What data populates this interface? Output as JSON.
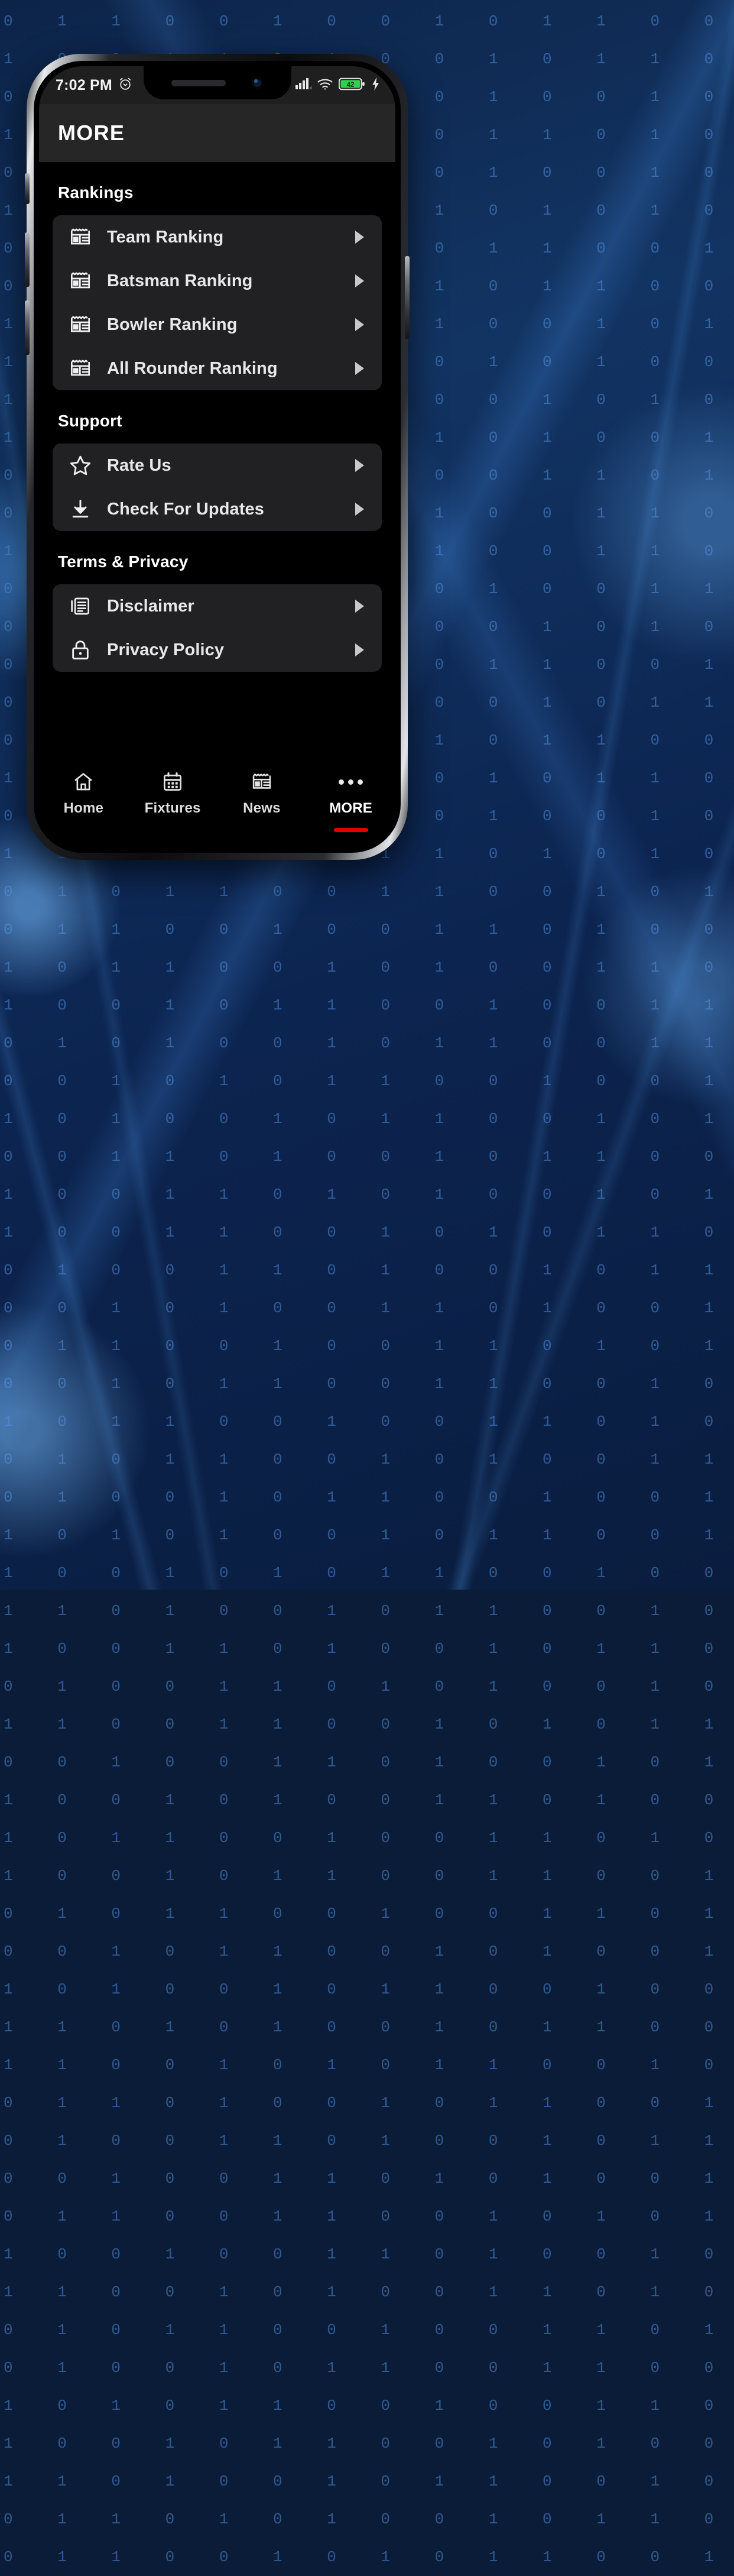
{
  "wallpaper": {
    "binary_pattern": "0 1 1 0 0 1 0 0 1 0 1 1 0 0 1 0 0 1 1 0 1 0 0 1 0 1 1 0 0 1 0 1 0 0 1 1 0 1 0 0 1 0 1 0 0 1 1 0 0 1 0 1 1 0 1 0 0 1 0 0 1 1 0 1 0 1 0 0 1 0 1 1 0 0 1 0 0 1 1 0 1 0 1 0 0 1 1 0 0 1 0 1 0 1 1 0 0 1 0 0 1 1 0 1 0 0 1 0 1 1 0 0 1 0 1 0 0 1 1 0 1 0 0 1 0 1 1 0 0 1 0 0 1 1 0 1 0 1 0 0 1 0 1 1 0 0 1 1 0 0 1 0 1 0 1 1 0 0 1 0 0 1 1 0 1 0 0 1 0 1 1 0 0 1 0 1 0 0 1 1 0 1 0 0 1 0 1 1 0 0 1 0 0 1 1 0 1 0 1 0 0 1 0 1 1 0 0 1 1 0 0 1 0 1 0 1 1 0 0 1 0 0 1 1 0 1 0 0 1 0 1 1 0 0 1 0 1 0 0 1 1 0 1 0 0 1 0 1 1 0 0 1 0 0 1 1 0 1 0 1 0 0 1 0 1 1 0 0 1 1 0 0 1 0 1 0 1 1 0 0 1 0 0 1 1 0 1 0 0 1 0 1 1 0 0 1 0 1 0 0 1 1 0 1 0 0 1 0 1 1 0 0 1 0 0 1 1 0 1 0 1 0 0 1 0 1 1 0 0 1 1 0 0 1 0 1 0 1 1 0 0 1 0 0 1 1 0 1 0 0 1 0 1 1 0 0 1 0 1 0 0 1 1 0 1 0 0 1 0 1 1 0 0 1 0 0 1 1 0 1 0 1 0 0 1 0 1 1 0 0 1 1 0 0 1 0 1 0 1 1 0 0 1 0 0 1 1 0 1 0 0 1 0 1 1 0 0 1 0 1 0 0 1 1 0 1 0 0 1 0 1 1 0 0 1 0 0 1 1 0 1 0 1 0 0 1 0 1 1 0 0 1 1 0 0 1 0 1 0 1 1 0 0 1 0 0 1 1 0 1 0 0 1 0 1 1 0 0 1 0 1 0 0 1 1 0 1 0 0 1 0 1 1 0 0 1 0 0 1 1 0 1 0 1 0 0 1 0 1 1 0 0 1 1 0 0 1 0 1 0 1 1 0 0 1 0 0 1 1 0 1 0 0 1 0 1 1 0 0 1 0 1 0 0 1 1 0 1 0 0 1 0 1 1 0 0 1 0 0 1 1 0 1 0 1 0 0 1 0 1 1 0 0 1 1 0 0 1 0 1 0 1 1 0 0 1 0 0 1 1 0 1 0 0 1 0 1 1 0 0 1 0 1 0 0 1 1 0 1 0 0 1 0 1 1 0 0 1 0 0 1 1 0 1 0 1 0 0 1 0 1 1 0 0 1 1 0 0 1 0 1 0 1 1 0 0 1 0 0 1 1 0 1 0 0 1 0 1 1 0 0 1 0 1 0 0 1 1 0 1 0 0 1 0 1 1 0 0 1 0 0 1 1 0 1 0 1 0 0 1 0 1 1 0 0 1 1 0 0 1 0 1 0 1 1 0 0 1 0 0 1 1 0 1 0 0 1 0 1 1 0 0 1 0 1 0 0 1 1 0 1 0 0 1 0 1 1 0 0 1 0 0 1 1 0 1 0 1 0 0 1 0 1 1 0 0 1 1 0 0 1 0 1 0 1 1 0 0 1 0 0 1 1 0 1 0 0 1 0 1 1 0 0 1 0 1 0 0 1 1 0 1 0 0 1 0 1 1 0 0 1 0 0 1 1 0 1 0 1 0 0 1 0 1 1 0 0 1 1 0 0 1 0 1 0 1 1 0 0 1 0 0 1 1 0 1 0 0 1 0 1 1 0 0 1 0 1 0 0 1 1 0 1 0 0 1 0 1 1 0 0 1 0 0 1 1 0 1 0 1 0 0 1 0 1 1 0 0 1 1 0 0 1 0 1 0 1 1 0 0 1 0 0 1 1 0 1 0 0 1 0 1 1 0 0 1 0 1 0 0 1 1 0 1 0 0 1 0 1 1 0 0 1 0 0 1 1 0 1 0 1 0 0 1 0 1 1 0 0 1 1 0 0 1 0 1 0 1 1 0 0 1"
  },
  "statusbar": {
    "time": "7:02 PM",
    "alarm_icon": "alarm-clock-icon",
    "signal_icon": "cellular-signal-icon",
    "wifi_icon": "wifi-icon",
    "battery_level": "42",
    "charging_icon": "charging-bolt-icon"
  },
  "appbar": {
    "title": "MORE"
  },
  "sections": [
    {
      "title": "Rankings",
      "items": [
        {
          "label": "Team Ranking",
          "icon": "article-ranking-icon",
          "chevron": "chevron-right-icon"
        },
        {
          "label": "Batsman Ranking",
          "icon": "article-ranking-icon",
          "chevron": "chevron-right-icon"
        },
        {
          "label": "Bowler Ranking",
          "icon": "article-ranking-icon",
          "chevron": "chevron-right-icon"
        },
        {
          "label": "All Rounder Ranking",
          "icon": "article-ranking-icon",
          "chevron": "chevron-right-icon"
        }
      ]
    },
    {
      "title": "Support",
      "items": [
        {
          "label": "Rate Us",
          "icon": "star-outline-icon",
          "chevron": "chevron-right-icon"
        },
        {
          "label": "Check For Updates",
          "icon": "download-icon",
          "chevron": "chevron-right-icon"
        }
      ]
    },
    {
      "title": "Terms & Privacy",
      "items": [
        {
          "label": "Disclaimer",
          "icon": "document-text-icon",
          "chevron": "chevron-right-icon"
        },
        {
          "label": "Privacy Policy",
          "icon": "lock-icon",
          "chevron": "chevron-right-icon"
        }
      ]
    }
  ],
  "bottom_nav": {
    "active_index": 3,
    "active_indicator_color": "#e00000",
    "items": [
      {
        "label": "Home",
        "icon": "home-icon"
      },
      {
        "label": "Fixtures",
        "icon": "calendar-icon"
      },
      {
        "label": "News",
        "icon": "newspaper-icon"
      },
      {
        "label": "MORE",
        "icon": "ellipsis-icon"
      }
    ]
  }
}
